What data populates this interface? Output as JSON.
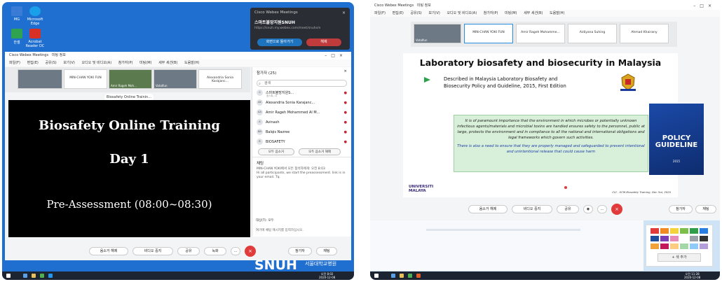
{
  "left": {
    "desktop_icons": [
      "MG",
      "Microsoft Edge",
      "한셀",
      "Acrobat Reader DC"
    ],
    "notification": {
      "app": "Cisco Webex Meetings",
      "host": "스마트볼망지원SNUH",
      "url": "https://snuh.my.webex.com/meet/snuhsm",
      "join_label": "화면으로 돌아가기",
      "end_label": "해제"
    },
    "window": {
      "title": "Cisco Webex Meetings",
      "subtitle": "미팅 정보",
      "menus": [
        "파일(F)",
        "편집(E)",
        "공유(S)",
        "보기(V)",
        "오디오 및 비디오(A)",
        "참가자(P)",
        "미팅(M)",
        "세부 세션(B)",
        "도움말(H)"
      ]
    },
    "thumbs": [
      {
        "name": "",
        "video": true,
        "label": ""
      },
      {
        "name": "MIN-CHAN YOKI FUN",
        "video": false,
        "label": ""
      },
      {
        "name": "",
        "video": true,
        "label": "Amir Rageh Moh..."
      },
      {
        "name": "",
        "video": true,
        "label": "Vatalfun"
      },
      {
        "name": "Alexandria Sonia Karajanc...",
        "video": false,
        "label": ""
      }
    ],
    "share_tab": "Biosafety Online Trainin...",
    "slide": {
      "line1": "Biosafety Online Training",
      "line2": "Day 1",
      "line3": "Pre-Assessment (08:00~08:30)"
    },
    "participants": {
      "header": "참가자 (25)",
      "search_placeholder": "검색",
      "rows": [
        {
          "initials": "스",
          "name": "스마트볼망지원S...",
          "sub": "호스트, 나"
        },
        {
          "initials": "AK",
          "name": "Alexandria Sonia Karajanc...",
          "sub": ""
        },
        {
          "initials": "AA",
          "name": "Amir Rageh Mohammed Al M...",
          "sub": ""
        },
        {
          "initials": "A",
          "name": "Avinash",
          "sub": ""
        },
        {
          "initials": "BN",
          "name": "Balqis Nazree",
          "sub": ""
        },
        {
          "initials": "B",
          "name": "BIOSAFETY",
          "sub": ""
        }
      ],
      "mute_all": "모두 음소거",
      "unmute_all": "모두 음소거 해제"
    },
    "chat": {
      "header": "채팅",
      "msg_from": "MIN-CHAN YOKI에서 모든 참석자에게:     오전 8:03",
      "msg_text": "Hi all participants, we start the preassessment. link is in your email. Tq.",
      "to_label": "대상(T):  모두",
      "input_placeholder": "여기에 채팅 메시지를 입력하십시오."
    },
    "controls": {
      "mute": "음소거 해제",
      "video": "비디오 중지",
      "share": "공유",
      "record": "녹화",
      "participants": "참가자",
      "chat": "채팅"
    },
    "brand": "SNUH",
    "brand_sub": "서울대학교병원",
    "clock": {
      "time": "오전 8:02",
      "date": "2020-12-08"
    }
  },
  "right": {
    "window": {
      "title": "Cisco Webex Meetings",
      "subtitle": "미팅 정보",
      "menus": [
        "파일(F)",
        "편집(E)",
        "공유(S)",
        "보기(V)",
        "오디오 및 비디오(A)",
        "참가자(P)",
        "미팅(M)",
        "세부 세션(B)",
        "도움말(H)"
      ]
    },
    "thumbs": [
      {
        "name": "",
        "video": true,
        "label": "Vatalfun"
      },
      {
        "name": "MIN-CHAN YOKI FUN",
        "video": false,
        "label": ""
      },
      {
        "name": "Amir Rageh Mohamme...",
        "video": false,
        "label": ""
      },
      {
        "name": "Aidiyana Suhing",
        "video": false,
        "label": ""
      },
      {
        "name": "Ahmad Khairany",
        "video": false,
        "label": ""
      }
    ],
    "slide": {
      "title": "Laboratory biosafety and biosecurity in Malaysia",
      "desc_line1": "Described in Malaysia Laboratory Biosafety and",
      "desc_line2": "Biosecurity Policy and Guideline, 2015, First Edition",
      "para1": "It is of paramount importance that the environment in which microbes or potentially unknown infectious agents/materials and microbial toxins are handled ensures safety to the personnel, public at large, protects the environment and in compliance to all the national and international obligations and legal frameworks which govern such activities.",
      "para2": "There is also a need to ensure that they are properly managed and safeguarded to prevent intentional and unintentional release that could cause harm",
      "book_line1": "POLICY",
      "book_line2": "GUIDELINE",
      "book_year": "2015",
      "um_line1": "UNIVERSITI",
      "um_line2": "MALAYA",
      "footer": "CLY - ECM Biosafety Training, Dec 3rd, 2020"
    },
    "controls": {
      "mute": "음소거 해제",
      "video": "비디오 중지",
      "share": "공유",
      "participants": "참가자",
      "chat": "채팅"
    },
    "palette": {
      "add_label": "+ 색 추가",
      "colors": [
        "#e23b3b",
        "#f08a24",
        "#f4d23c",
        "#7cc04b",
        "#2f9d4a",
        "#2a7de1",
        "#1f4e9c",
        "#7a3fb5",
        "#e58bb8",
        "#ffffff",
        "#9aa1a8",
        "#333333",
        "#f2a23a",
        "#c2185b",
        "#ffcc80",
        "#a5d6a7",
        "#90caf9",
        "#b39ddb",
        "#ef9a9a",
        "#ffe082",
        "#80cbc4",
        "#c5e1a5",
        "#ce93d8",
        "#bcaaa4"
      ]
    },
    "clock": {
      "time": "오전 11:28",
      "date": "2020-12-08"
    }
  }
}
